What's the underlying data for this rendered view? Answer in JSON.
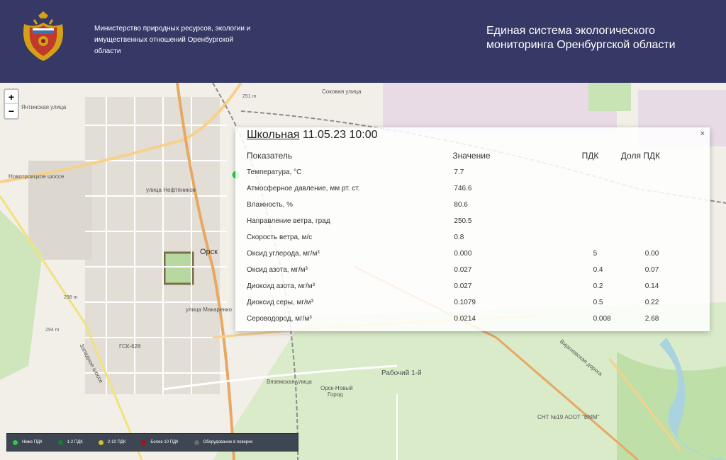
{
  "header": {
    "ministry": "Министерство природных ресурсов, экологии и имущественных отношений Оренбургской области",
    "system_title": "Единая система экологического мониторинга Оренбургской области"
  },
  "map": {
    "zoom_in": "+",
    "zoom_out": "−",
    "labels": {
      "orsk": "Орск",
      "rabochiy": "Рабочий 1-й",
      "orsk_novy_1": "Орск-Новый",
      "orsk_novy_2": "Город",
      "gsk": "ГСК-628",
      "elev1": "298 m",
      "elev2": "294 m",
      "elev3": "251 m",
      "street1": "Вяземская улица",
      "street2": "Новотроицкое шоссе",
      "street3": "улица Нефтяников",
      "street4": "Западное шоссе",
      "street5": "улица Макаренко",
      "street6": "Кутузовская улица",
      "street7": "Вирхновская дорога",
      "street8": "Ячтинская улица",
      "street9": "Соковая улица",
      "snt": "СНТ №19 АООТ \"ВММ\""
    }
  },
  "popup": {
    "close": "×",
    "station": "Школьная",
    "datetime": "11.05.23 10:00",
    "columns": [
      "Показатель",
      "Значение",
      "ПДК",
      "Доля ПДК"
    ],
    "rows": [
      {
        "name": "Температура, °С",
        "value": "7.7",
        "pdk": "",
        "share": ""
      },
      {
        "name": "Атмосферное давление, мм рт. ст.",
        "value": "746.6",
        "pdk": "",
        "share": ""
      },
      {
        "name": "Влажность, %",
        "value": "80.6",
        "pdk": "",
        "share": ""
      },
      {
        "name": "Направление ветра, град",
        "value": "250.5",
        "pdk": "",
        "share": ""
      },
      {
        "name": "Скорость ветра, м/с",
        "value": "0.8",
        "pdk": "",
        "share": ""
      },
      {
        "name": "Оксид углерода, мг/м³",
        "value": "0.000",
        "pdk": "5",
        "share": "0.00"
      },
      {
        "name": "Оксид азота, мг/м³",
        "value": "0.027",
        "pdk": "0.4",
        "share": "0.07"
      },
      {
        "name": "Диоксид азота, мг/м³",
        "value": "0.027",
        "pdk": "0.2",
        "share": "0.14"
      },
      {
        "name": "Диоксид серы, мг/м³",
        "value": "0.1079",
        "pdk": "0.5",
        "share": "0.22"
      },
      {
        "name": "Сероводород, мг/м³",
        "value": "0.0214",
        "pdk": "0.008",
        "share": "2.68"
      }
    ]
  },
  "legend": [
    {
      "label": "Ниже ПДК",
      "color": "#2ecc40"
    },
    {
      "label": "1-2 ПДК",
      "color": "#1a7a3a"
    },
    {
      "label": "2-10 ПДК",
      "color": "#d4c030"
    },
    {
      "label": "Более 10 ПДК",
      "color": "#b01010"
    },
    {
      "label": "Оборудование в поверке",
      "color": "#6b6b6b"
    }
  ]
}
